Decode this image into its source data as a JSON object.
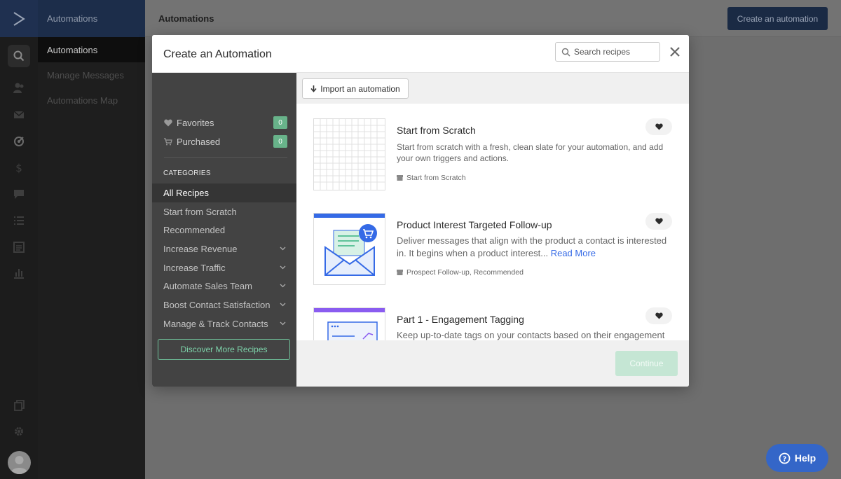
{
  "nav": {
    "section_title": "Automations",
    "items": [
      {
        "label": "Automations"
      },
      {
        "label": "Manage Messages"
      },
      {
        "label": "Automations Map"
      }
    ],
    "rail_icons": [
      "logo-icon",
      "search-icon",
      "contacts-icon",
      "mail-icon",
      "automations-icon",
      "dollar-icon",
      "chat-icon",
      "list-icon",
      "forms-icon",
      "reports-icon",
      "pages-icon",
      "settings-icon"
    ]
  },
  "topbar": {
    "title": "Automations",
    "create_label": "Create an automation"
  },
  "modal": {
    "title": "Create an Automation",
    "search_placeholder": "Search recipes",
    "sidebar": {
      "favorites_label": "Favorites",
      "favorites_count": "0",
      "purchased_label": "Purchased",
      "purchased_count": "0",
      "categories_heading": "CATEGORIES",
      "categories": [
        {
          "label": "All Recipes"
        },
        {
          "label": "Start from Scratch"
        },
        {
          "label": "Recommended"
        },
        {
          "label": "Increase Revenue"
        },
        {
          "label": "Increase Traffic"
        },
        {
          "label": "Automate Sales Team"
        },
        {
          "label": "Boost Contact Satisfaction"
        },
        {
          "label": "Manage & Track Contacts"
        }
      ],
      "discover_label": "Discover More Recipes"
    },
    "import_label": "Import an automation",
    "recipes": [
      {
        "title": "Start from Scratch",
        "desc": "Start from scratch with a fresh, clean slate for your automation, and add your own triggers and actions.",
        "tags": "Start from Scratch"
      },
      {
        "title": "Product Interest Targeted Follow-up",
        "desc": "Deliver messages that align with the product a contact is interested in. It begins when a product interest...",
        "read_more": "Read More",
        "tags": "Prospect Follow-up, Recommended"
      },
      {
        "title": "Part 1 - Engagement Tagging",
        "desc": "Keep up-to-date tags on your contacts based on their engagement level."
      }
    ],
    "continue_label": "Continue"
  },
  "help": {
    "label": "Help"
  },
  "colors": {
    "accent_green": "#68b38a",
    "brand_blue": "#3466c8",
    "link_blue": "#356ae6",
    "navy": "#1a2a44"
  }
}
